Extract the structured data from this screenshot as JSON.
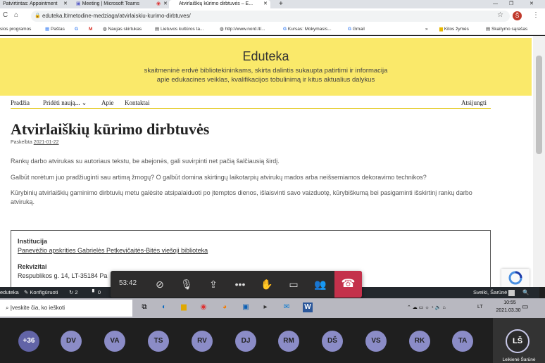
{
  "browser": {
    "tabs": [
      {
        "label": "Patvirtintas: Appointment"
      },
      {
        "label": "Meeting | Microsoft Teams"
      },
      {
        "label": "Atvirlaiškių kūrimo dirbtuvės – E..."
      }
    ],
    "url": "eduteka.lt/metodine-medziaga/atvirlaiskiu-kurimo-dirbtuves/",
    "profile_initial": "Š",
    "bookmarks": [
      "sios programos",
      "Paštas",
      "G",
      "M",
      "Naujas skirtukas",
      "Lietuvos kultūros ta...",
      "http://www.nord.lt/...",
      "Kursas: Mokymasis...",
      "Gmail",
      "»",
      "Kitos žymės",
      "Skaitymo sąrašas"
    ]
  },
  "site": {
    "title": "Eduteka",
    "tagline_1": "skaitmeninė erdvė bibliotekininkams, skirta dalintis sukaupta patirtimi ir informacija",
    "tagline_2": "apie edukacines veiklas, kvalifikacijos tobulinimą ir kitus aktualius dalykus",
    "nav": {
      "home": "Pradžia",
      "add_new": "Pridėti naują...",
      "about": "Apie",
      "contacts": "Kontaktai",
      "logout": "Atsijungti"
    }
  },
  "post": {
    "title": "Atvirlaiškių kūrimo dirbtuvės",
    "posted_label": "Paskelbta",
    "posted_date": "2021-01-22",
    "paragraphs": [
      "Rankų darbo atvirukas su autoriaus tekstu, be abejonės, gali suvirpinti net pačią šalčiausią širdį.",
      "Galbūt norėtum juo pradžiuginti sau artimą žmogų? O galbūt domina skirtingų laikotarpių atvirukų mados arba neišsemiamos dekoravimo technikos?",
      "Kūrybinių atvirlaiškių gaminimo dirbtuvių metu galėsite atsipalaiduoti po įtemptos dienos, išlaisvinti savo vaizduotę, kūrybiškumą bei pasigaminti išskirtinį rankų darbo atviruką."
    ],
    "info": {
      "institution_label": "Institucija",
      "institution_value": "Panevėžio apskrities Gabrielės Petkevičaitės-Bitės viešoji biblioteka",
      "details_label": "Rekvizitai",
      "details_value": "Respublikos g. 14, LT-35184 Pa"
    }
  },
  "adminbar": {
    "site": "eduteka",
    "customize": "Konfigūruoti",
    "updates": "2",
    "comments": "0",
    "greeting": "Sveiki, Šarūnė"
  },
  "call": {
    "timer": "53:42"
  },
  "taskbar": {
    "search_placeholder": "Įveskite čia, ko ieškoti",
    "lang": "LT",
    "time": "10:55",
    "date": "2021.03.30"
  },
  "participants": {
    "overflow": "+36",
    "people": [
      "DV",
      "VA",
      "TS",
      "RV",
      "DJ",
      "RM",
      "DŠ",
      "VS",
      "RK",
      "TA"
    ],
    "self_initials": "LŠ",
    "self_name": "Leikienė Šarūnė"
  },
  "colors": {
    "hero": "#fae96a",
    "hangup": "#c4314b",
    "avatar": "#8b8cc7",
    "adminbar": "#23282d"
  }
}
